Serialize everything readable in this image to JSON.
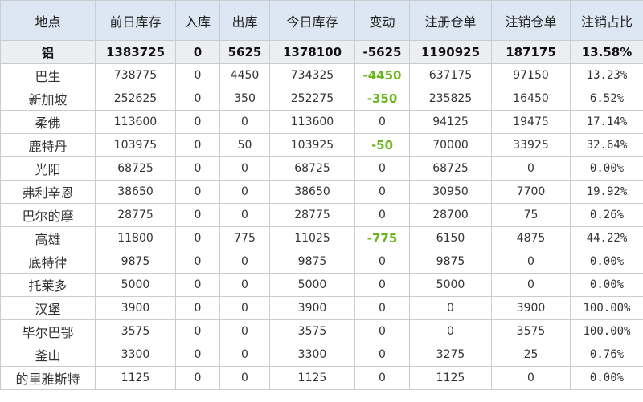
{
  "headers": [
    "地点",
    "前日库存",
    "入库",
    "出库",
    "今日库存",
    "变动",
    "注册仓单",
    "注销仓单",
    "注销占比"
  ],
  "total": [
    "铝",
    "1383725",
    "0",
    "5625",
    "1378100",
    "-5625",
    "1190925",
    "187175",
    "13.58%"
  ],
  "rows": [
    [
      "巴生",
      "738775",
      "0",
      "4450",
      "734325",
      "-4450",
      "637175",
      "97150",
      "13.23%"
    ],
    [
      "新加坡",
      "252625",
      "0",
      "350",
      "252275",
      "-350",
      "235825",
      "16450",
      "6.52%"
    ],
    [
      "柔佛",
      "113600",
      "0",
      "0",
      "113600",
      "0",
      "94125",
      "19475",
      "17.14%"
    ],
    [
      "鹿特丹",
      "103975",
      "0",
      "50",
      "103925",
      "-50",
      "70000",
      "33925",
      "32.64%"
    ],
    [
      "光阳",
      "68725",
      "0",
      "0",
      "68725",
      "0",
      "68725",
      "0",
      "0.00%"
    ],
    [
      "弗利辛恩",
      "38650",
      "0",
      "0",
      "38650",
      "0",
      "30950",
      "7700",
      "19.92%"
    ],
    [
      "巴尔的摩",
      "28775",
      "0",
      "0",
      "28775",
      "0",
      "28700",
      "75",
      "0.26%"
    ],
    [
      "高雄",
      "11800",
      "0",
      "775",
      "11025",
      "-775",
      "6150",
      "4875",
      "44.22%"
    ],
    [
      "底特律",
      "9875",
      "0",
      "0",
      "9875",
      "0",
      "9875",
      "0",
      "0.00%"
    ],
    [
      "托莱多",
      "5000",
      "0",
      "0",
      "5000",
      "0",
      "5000",
      "0",
      "0.00%"
    ],
    [
      "汉堡",
      "3900",
      "0",
      "0",
      "3900",
      "0",
      "0",
      "3900",
      "100.00%"
    ],
    [
      "毕尔巴鄂",
      "3575",
      "0",
      "0",
      "3575",
      "0",
      "0",
      "3575",
      "100.00%"
    ],
    [
      "釜山",
      "3300",
      "0",
      "0",
      "3300",
      "0",
      "3275",
      "25",
      "0.76%"
    ],
    [
      "的里雅斯特",
      "1125",
      "0",
      "0",
      "1125",
      "0",
      "1125",
      "0",
      "0.00%"
    ]
  ],
  "colors": {
    "header_bg": "#dde7f3",
    "total_bg": "#eceef1",
    "negative_change": "#6bb51e",
    "border": "#c9ccd0"
  }
}
